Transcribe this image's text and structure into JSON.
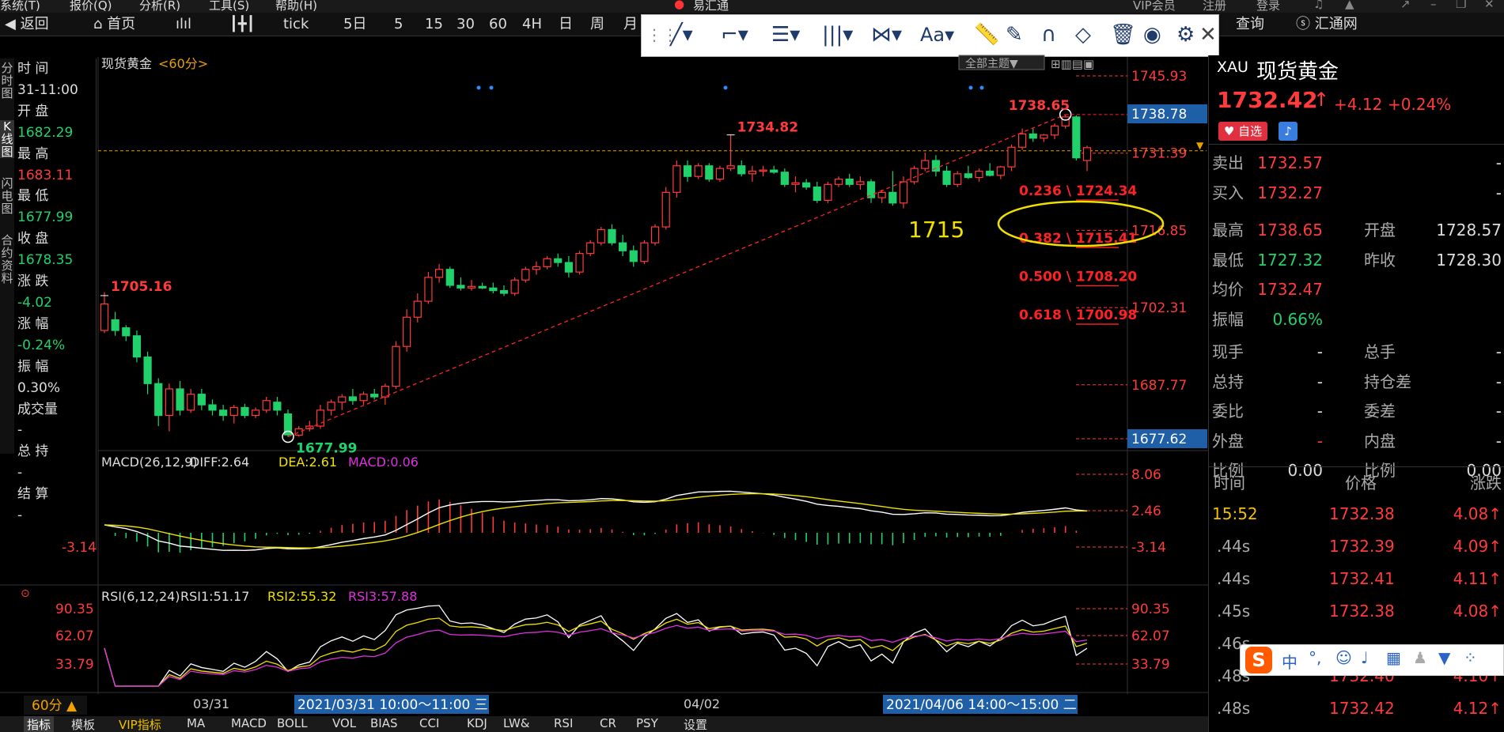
{
  "app": {
    "title": "易汇通",
    "vip": "VIP会员",
    "register": "注册",
    "login": "登录"
  },
  "menu": [
    "系统(T)",
    "报价(Q)",
    "分析(R)",
    "工具(S)",
    "帮助(H)"
  ],
  "toolbar": {
    "back": "返回",
    "home": "首页",
    "tick": "tick",
    "periods": [
      "5日",
      "5",
      "15",
      "30",
      "60",
      "4H",
      "日",
      "周",
      "月"
    ],
    "query": "查询",
    "huitongwang": "汇通网"
  },
  "drawtools": {
    "font": "Aa"
  },
  "leftbar": [
    "分时图",
    "K线图",
    "闪电图",
    "合约资料"
  ],
  "info": {
    "time_label": "时 间",
    "time": "31-11:00",
    "open_label": "开 盘",
    "open": "1682.29",
    "high_label": "最 高",
    "high": "1683.11",
    "low_label": "最 低",
    "low": "1677.99",
    "close_label": "收 盘",
    "close": "1678.35",
    "change_label": "涨 跌",
    "change": "-4.02",
    "changepct_label": "涨 幅",
    "changepct": "-0.24%",
    "amplitude_label": "振 幅",
    "amplitude": "0.30%",
    "volume_label": "成交量",
    "volume": "-",
    "oi_label": "总 持",
    "oi": "-",
    "settle_label": "结 算",
    "settle": "-"
  },
  "chart": {
    "title": "现货黄金",
    "period": "<60分>",
    "theme_btn": "全部主题▼",
    "price_labels": [
      "1745.93",
      "1731.39",
      "1716.85",
      "1702.31",
      "1687.77"
    ],
    "current_price_tag": "1738.78",
    "low_price_tag": "1677.62",
    "annotations": {
      "high1": "1734.82",
      "high2": "1738.65",
      "left_high": "1705.16",
      "low": "1677.99",
      "handwritten": "1715"
    },
    "fib": [
      "0.236 \\ 1724.34",
      "0.382 \\ 1715.41",
      "0.500 \\ 1708.20",
      "0.618 \\ 1700.98"
    ],
    "macd": {
      "header": "MACD(26,12,9)",
      "diff": "DIFF:2.64",
      "dea": "DEA:2.61",
      "macd": "MACD:0.06",
      "labels": [
        "8.06",
        "2.46",
        "-3.14"
      ],
      "left_label": "-3.14"
    },
    "rsi": {
      "header": "RSI(6,12,24)",
      "rsi1": "RSI1:51.17",
      "rsi2": "RSI2:55.32",
      "rsi3": "RSI3:57.88",
      "labels": [
        "90.35",
        "62.07",
        "33.79"
      ]
    },
    "period_btn": "60分 ▲",
    "dates": [
      "03/31",
      "04/02"
    ],
    "range1": "2021/03/31 10:00～11:00 三",
    "range2": "2021/04/06 14:00～15:00 二",
    "colors": {
      "up": "#ff3b3b",
      "down": "#21d26b",
      "fib": "#ff2222",
      "highlight": "#f0e000"
    }
  },
  "candles": [
    [
      1698,
      1705.2,
      1697.5,
      1703
    ],
    [
      1700,
      1701.5,
      1697,
      1698
    ],
    [
      1698.5,
      1699,
      1696,
      1697
    ],
    [
      1697,
      1698,
      1692,
      1693
    ],
    [
      1693,
      1694,
      1686,
      1688
    ],
    [
      1688,
      1689,
      1680,
      1682
    ],
    [
      1682,
      1688,
      1679,
      1687
    ],
    [
      1687,
      1688.5,
      1682,
      1683
    ],
    [
      1683,
      1687,
      1682.5,
      1686
    ],
    [
      1686,
      1687,
      1683,
      1684
    ],
    [
      1684,
      1685,
      1682,
      1683
    ],
    [
      1683,
      1684,
      1681,
      1682
    ],
    [
      1682,
      1684,
      1680.5,
      1683.5
    ],
    [
      1683.5,
      1684.2,
      1681.5,
      1682
    ],
    [
      1682,
      1683.5,
      1681.5,
      1683
    ],
    [
      1683,
      1685.5,
      1682.5,
      1684.8
    ],
    [
      1684.5,
      1685.5,
      1682,
      1683
    ],
    [
      1682.29,
      1683.11,
      1677.99,
      1678.35
    ],
    [
      1678.3,
      1680,
      1678,
      1679.5
    ],
    [
      1679.5,
      1681,
      1679,
      1680
    ],
    [
      1680,
      1684,
      1679.5,
      1683
    ],
    [
      1683,
      1685,
      1682,
      1684.5
    ],
    [
      1684.5,
      1686,
      1683,
      1685.5
    ],
    [
      1685.5,
      1687,
      1684,
      1684.8
    ],
    [
      1684.8,
      1686.5,
      1684,
      1686
    ],
    [
      1686,
      1687,
      1685,
      1685.5
    ],
    [
      1685.5,
      1688,
      1684,
      1687.5
    ],
    [
      1687.5,
      1696,
      1687,
      1695
    ],
    [
      1695,
      1702,
      1694,
      1700.5
    ],
    [
      1700.5,
      1705,
      1699.5,
      1703.5
    ],
    [
      1703.5,
      1709,
      1703,
      1708
    ],
    [
      1708,
      1710.5,
      1707,
      1709.5
    ],
    [
      1709.5,
      1710,
      1706,
      1706.5
    ],
    [
      1706.5,
      1708,
      1705.5,
      1706
    ],
    [
      1706,
      1707.5,
      1705.5,
      1706.3
    ],
    [
      1706.3,
      1707,
      1705.8,
      1706
    ],
    [
      1706,
      1707,
      1705,
      1705.5
    ],
    [
      1705.5,
      1706.5,
      1704.5,
      1705
    ],
    [
      1705,
      1708,
      1704.5,
      1707.5
    ],
    [
      1707.5,
      1710,
      1707,
      1709.5
    ],
    [
      1709.5,
      1711,
      1708.5,
      1710
    ],
    [
      1710,
      1712,
      1709.5,
      1711.5
    ],
    [
      1711.5,
      1712.5,
      1710,
      1710.8
    ],
    [
      1710.8,
      1712,
      1708,
      1709
    ],
    [
      1709,
      1713,
      1708.5,
      1712.5
    ],
    [
      1712.5,
      1715,
      1712,
      1714.5
    ],
    [
      1714.5,
      1717.5,
      1714,
      1717
    ],
    [
      1717,
      1718,
      1714,
      1714.5
    ],
    [
      1714.5,
      1716,
      1712,
      1713
    ],
    [
      1713,
      1714,
      1710,
      1711
    ],
    [
      1711,
      1715,
      1710.5,
      1714.5
    ],
    [
      1714.5,
      1718,
      1714,
      1717.5
    ],
    [
      1717.5,
      1725,
      1717,
      1724
    ],
    [
      1724,
      1730,
      1723,
      1729
    ],
    [
      1729,
      1730,
      1726,
      1727
    ],
    [
      1727,
      1729.5,
      1726.5,
      1729
    ],
    [
      1729,
      1729.5,
      1726,
      1726.5
    ],
    [
      1726.5,
      1729,
      1726,
      1728.5
    ],
    [
      1728.5,
      1734.82,
      1728,
      1729
    ],
    [
      1729,
      1730,
      1727,
      1727.5
    ],
    [
      1727.5,
      1729,
      1726,
      1728
    ],
    [
      1728,
      1729,
      1727,
      1728.2
    ],
    [
      1728.2,
      1729,
      1727.5,
      1727.8
    ],
    [
      1727.8,
      1728.5,
      1725,
      1725.5
    ],
    [
      1725.5,
      1727,
      1724,
      1725.8
    ],
    [
      1725.8,
      1726.5,
      1724.5,
      1725
    ],
    [
      1725,
      1726,
      1722,
      1722.5
    ],
    [
      1722.5,
      1726,
      1722,
      1725.5
    ],
    [
      1725.5,
      1727,
      1725,
      1726.5
    ],
    [
      1726.5,
      1727.5,
      1725,
      1725.5
    ],
    [
      1725.5,
      1727,
      1724.5,
      1726
    ],
    [
      1726,
      1726.5,
      1722,
      1723
    ],
    [
      1723,
      1724.5,
      1722,
      1724
    ],
    [
      1724,
      1728,
      1721.5,
      1722
    ],
    [
      1722,
      1727,
      1721,
      1726
    ],
    [
      1726,
      1729,
      1725.5,
      1728.5
    ],
    [
      1728.5,
      1731.5,
      1728,
      1730
    ],
    [
      1730,
      1731,
      1727,
      1728
    ],
    [
      1728,
      1729,
      1725,
      1725.5
    ],
    [
      1725.5,
      1728,
      1725,
      1727.5
    ],
    [
      1727.5,
      1729,
      1726.5,
      1726.8
    ],
    [
      1726.8,
      1728.5,
      1726,
      1728
    ],
    [
      1728,
      1729.5,
      1727,
      1727.2
    ],
    [
      1727.2,
      1729,
      1726.5,
      1728.8
    ],
    [
      1728.8,
      1733,
      1728,
      1732.5
    ],
    [
      1732.5,
      1736,
      1732,
      1735
    ],
    [
      1735,
      1736,
      1733.5,
      1734.2
    ],
    [
      1734.2,
      1735,
      1733.5,
      1734.8
    ],
    [
      1734.8,
      1737,
      1734,
      1736.5
    ],
    [
      1736.5,
      1738.65,
      1736,
      1738.2
    ],
    [
      1738.2,
      1738.5,
      1730,
      1730.5
    ],
    [
      1730,
      1732.8,
      1728,
      1732.42
    ]
  ],
  "right": {
    "symbol": "XAU",
    "name": "现货黄金",
    "price": "1732.42",
    "arrow": "↑",
    "change": "+4.12",
    "changepct": "+0.24%",
    "fav": "自选",
    "rows": [
      {
        "l1": "卖出",
        "v1": "1732.57",
        "l2": "",
        "v2": "-"
      },
      {
        "l1": "买入",
        "v1": "1732.27",
        "l2": "",
        "v2": "-"
      },
      {
        "l1": "最高",
        "v1": "1738.65",
        "l2": "开盘",
        "v2": "1728.57"
      },
      {
        "l1": "最低",
        "v1": "1727.32",
        "l2": "昨收",
        "v2": "1728.30"
      },
      {
        "l1": "均价",
        "v1": "1732.47",
        "l2": "",
        "v2": ""
      },
      {
        "l1": "振幅",
        "v1": "0.66%",
        "l2": "",
        "v2": ""
      },
      {
        "l1": "现手",
        "v1": "-",
        "l2": "总手",
        "v2": "-"
      },
      {
        "l1": "总持",
        "v1": "-",
        "l2": "持仓差",
        "v2": "-"
      },
      {
        "l1": "委比",
        "v1": "-",
        "l2": "委差",
        "v2": "-"
      },
      {
        "l1": "外盘",
        "v1": "-",
        "l2": "内盘",
        "v2": "-"
      },
      {
        "l1": "比例",
        "v1": "0.00",
        "l2": "比例",
        "v2": "0.00"
      }
    ],
    "tick_header": {
      "time": "时间",
      "price": "价格",
      "change": "涨跌"
    },
    "ticks": [
      {
        "time": "15:52",
        "price": "1732.38",
        "chg": "4.08↑"
      },
      {
        "time": ".44s",
        "price": "1732.39",
        "chg": "4.09↑"
      },
      {
        "time": ".44s",
        "price": "1732.41",
        "chg": "4.11↑"
      },
      {
        "time": ".45s",
        "price": "1732.38",
        "chg": "4.08↑"
      },
      {
        "time": ".46s",
        "price": "",
        "chg": ""
      },
      {
        "time": ".48s",
        "price": "1732.40",
        "chg": "4.10↑"
      },
      {
        "time": ".48s",
        "price": "1732.42",
        "chg": "4.12↑"
      }
    ]
  },
  "bottom_tabs": [
    "指标",
    "模板",
    "VIP指标",
    "MA",
    "MACD",
    "BOLL",
    "VOL",
    "BIAS",
    "CCI",
    "KDJ",
    "LW&",
    "RSI",
    "CR",
    "PSY",
    "设置"
  ],
  "ime": {
    "label": "中"
  }
}
